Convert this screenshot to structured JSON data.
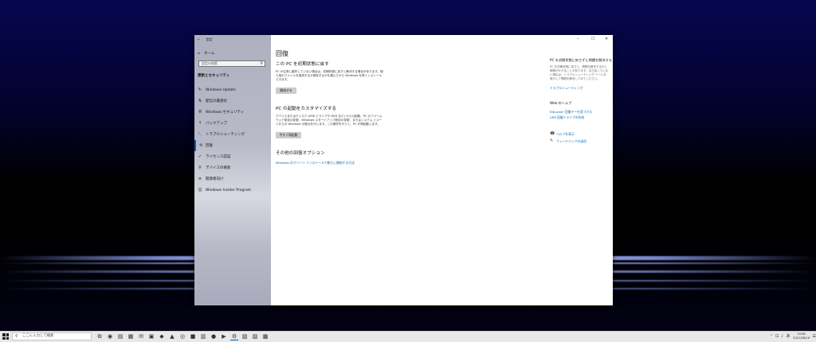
{
  "window": {
    "back_label": "←",
    "title": "設定",
    "min": "–",
    "max": "☐",
    "close": "✕"
  },
  "sidebar": {
    "home": "ホーム",
    "search_placeholder": "設定の検索",
    "section": "更新とセキュリティ",
    "items": [
      {
        "label": "Windows Update",
        "icon": "↻"
      },
      {
        "label": "配信の最適化",
        "icon": "⇅"
      },
      {
        "label": "Windows セキュリティ",
        "icon": "⛨"
      },
      {
        "label": "バックアップ",
        "icon": "↑"
      },
      {
        "label": "トラブルシューティング",
        "icon": "🔧"
      },
      {
        "label": "回復",
        "icon": "⟲"
      },
      {
        "label": "ライセンス認証",
        "icon": "✓"
      },
      {
        "label": "デバイスの検索",
        "icon": "⚲"
      },
      {
        "label": "開発者向け",
        "icon": "≡"
      },
      {
        "label": "Windows Insider Program",
        "icon": "☺"
      }
    ]
  },
  "main": {
    "title": "回復",
    "reset": {
      "heading": "この PC を初期状態に戻す",
      "body": "PC が正常に動作していない場合は、初期状態に戻すと解決する場合があります。個人用のファイルを保持するか削除するかを選んでから Windows を再インストールできます。",
      "button": "開始する"
    },
    "startup": {
      "heading": "PC の起動をカスタマイズする",
      "body": "デバイスまたはディスク (USB ドライブや DVD など) からの起動、PC のファームウェア設定の変更、Windows スタートアップ設定の変更、またはシステム イメージからの Windows の復元を行います。この操作を行うと、PC が再起動します。",
      "button": "今すぐ再起動"
    },
    "more": {
      "heading": "その他の回復オプション",
      "link": "Windows のクリーン インストールで新たに開始する方法"
    }
  },
  "right": {
    "heading": "PC を初期状態に戻さずに問題を解決する",
    "body": "PC を初期状態に戻すと、問題を解決するのに時間がかかることがあります。まだ戻していない場合は、トラブルシューティング ツールを実行して問題を解決してみてください。",
    "link": "トラブルシューティング",
    "web_heading": "Web のヘルプ",
    "web_links": [
      "BitLocker 回復キーを見つける",
      "USB 回復ドライブの作成"
    ],
    "help": "ヘルプを表示",
    "feedback": "フィードバックの送信"
  },
  "taskbar": {
    "search_placeholder": "ここに入力して検索",
    "time": "19:58",
    "date": "2021/08/16"
  }
}
